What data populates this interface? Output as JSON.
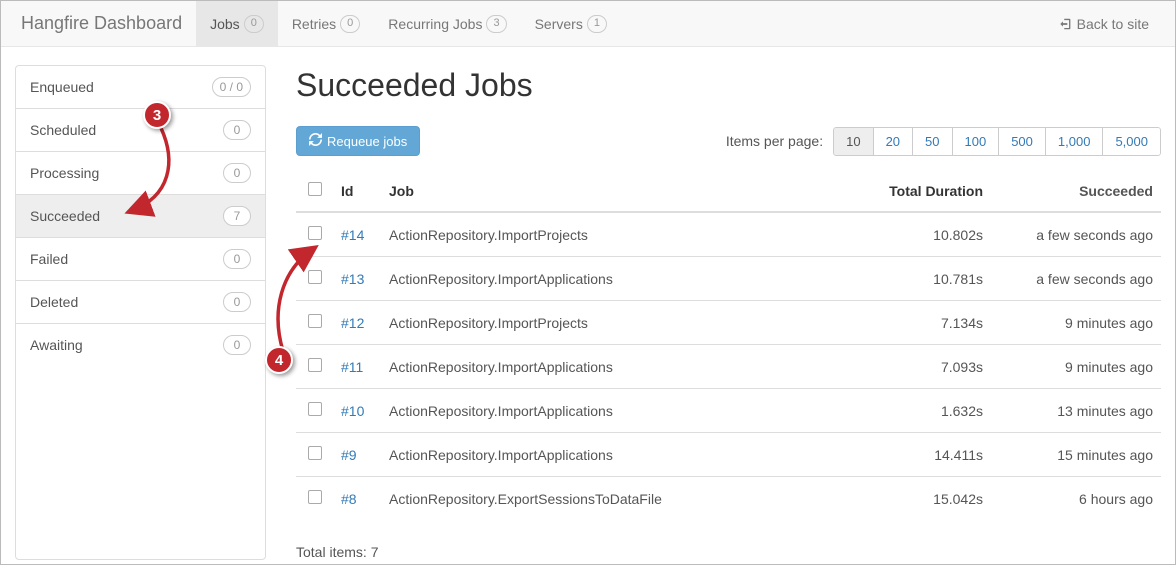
{
  "nav": {
    "brand": "Hangfire Dashboard",
    "items": [
      {
        "label": "Jobs",
        "count": "0",
        "active": true
      },
      {
        "label": "Retries",
        "count": "0",
        "active": false
      },
      {
        "label": "Recurring Jobs",
        "count": "3",
        "active": false
      },
      {
        "label": "Servers",
        "count": "1",
        "active": false
      }
    ],
    "back_label": "Back to site"
  },
  "sidebar": {
    "items": [
      {
        "label": "Enqueued",
        "count": "0 / 0",
        "active": false
      },
      {
        "label": "Scheduled",
        "count": "0",
        "active": false
      },
      {
        "label": "Processing",
        "count": "0",
        "active": false
      },
      {
        "label": "Succeeded",
        "count": "7",
        "active": true
      },
      {
        "label": "Failed",
        "count": "0",
        "active": false
      },
      {
        "label": "Deleted",
        "count": "0",
        "active": false
      },
      {
        "label": "Awaiting",
        "count": "0",
        "active": false
      }
    ]
  },
  "page": {
    "title": "Succeeded Jobs",
    "requeue_label": "Requeue jobs",
    "per_page_label": "Items per page:",
    "page_sizes": [
      "10",
      "20",
      "50",
      "100",
      "500",
      "1,000",
      "5,000"
    ],
    "page_size_active": "10",
    "columns": {
      "id": "Id",
      "job": "Job",
      "duration": "Total Duration",
      "succeeded": "Succeeded"
    },
    "rows": [
      {
        "id": "#14",
        "job": "ActionRepository.ImportProjects",
        "duration": "10.802s",
        "succeeded": "a few seconds ago"
      },
      {
        "id": "#13",
        "job": "ActionRepository.ImportApplications",
        "duration": "10.781s",
        "succeeded": "a few seconds ago"
      },
      {
        "id": "#12",
        "job": "ActionRepository.ImportProjects",
        "duration": "7.134s",
        "succeeded": "9 minutes ago"
      },
      {
        "id": "#11",
        "job": "ActionRepository.ImportApplications",
        "duration": "7.093s",
        "succeeded": "9 minutes ago"
      },
      {
        "id": "#10",
        "job": "ActionRepository.ImportApplications",
        "duration": "1.632s",
        "succeeded": "13 minutes ago"
      },
      {
        "id": "#9",
        "job": "ActionRepository.ImportApplications",
        "duration": "14.411s",
        "succeeded": "15 minutes ago"
      },
      {
        "id": "#8",
        "job": "ActionRepository.ExportSessionsToDataFile",
        "duration": "15.042s",
        "succeeded": "6 hours ago"
      }
    ],
    "total_label": "Total items: 7"
  },
  "annotations": {
    "badge3": "3",
    "badge4": "4"
  }
}
